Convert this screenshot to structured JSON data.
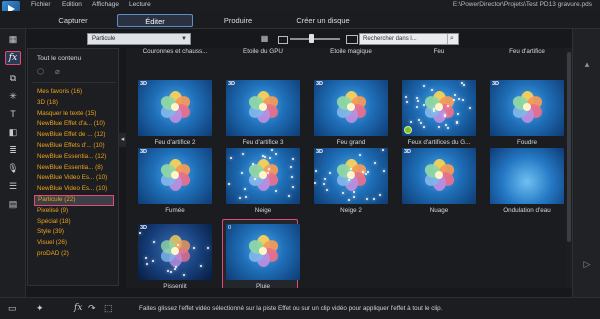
{
  "menu": {
    "items": [
      "Fichier",
      "Edition",
      "Affichage",
      "Lecture"
    ],
    "file_path": "E:\\PowerDirector\\Projets\\Test PD13 gravure.pds"
  },
  "modes": {
    "tabs": [
      "Capturer",
      "Éditer",
      "Produire",
      "Créer un disque"
    ],
    "active": "Éditer"
  },
  "filter": {
    "selected": "Particule",
    "search_placeholder": "Rechercher dans l..."
  },
  "categories": {
    "header": "Tout le contenu",
    "items": [
      "Mes favoris  (16)",
      "3D  (18)",
      "Masquer le texte  (15)",
      "NewBlue Effet d'a...  (10)",
      "NewBlue Effet de ...  (12)",
      "NewBlue Effets d'...  (10)",
      "NewBlue Essentia...  (12)",
      "NewBlue Essentia...  (8)",
      "NewBlue Video Es...  (10)",
      "NewBlue Video Es...  (10)",
      "Particule  (22)",
      "Pixelisé  (9)",
      "Spécial  (18)",
      "Style  (39)",
      "Visuel  (26)",
      "proDAD  (2)"
    ],
    "selected_index": 10
  },
  "effects": [
    {
      "label": "Couronnes et chauss...",
      "badge": "",
      "variant": "cut"
    },
    {
      "label": "Étoile du GPU",
      "badge": "",
      "variant": "cut"
    },
    {
      "label": "Étoile magique",
      "badge": "",
      "variant": "cut"
    },
    {
      "label": "Feu",
      "badge": "",
      "variant": "cut"
    },
    {
      "label": "Feu d'artifice",
      "badge": "",
      "variant": "cut"
    },
    {
      "label": "Feu d'artifice 2",
      "badge": "3D",
      "variant": "flower"
    },
    {
      "label": "Feu d'artifice 3",
      "badge": "3D",
      "variant": "flower"
    },
    {
      "label": "Feu grand",
      "badge": "3D",
      "variant": "flower"
    },
    {
      "label": "Feux d'artifices du G...",
      "badge": "",
      "variant": "burst"
    },
    {
      "label": "Foudre",
      "badge": "3D",
      "variant": "flower"
    },
    {
      "label": "Fumée",
      "badge": "3D",
      "variant": "flower"
    },
    {
      "label": "Neige",
      "badge": "",
      "variant": "snow"
    },
    {
      "label": "Neige 2",
      "badge": "3D",
      "variant": "snow"
    },
    {
      "label": "Nuage",
      "badge": "3D",
      "variant": "flower"
    },
    {
      "label": "Ondulation d'eau",
      "badge": "",
      "variant": "water"
    },
    {
      "label": "Pissenlit",
      "badge": "3D",
      "variant": "dark"
    },
    {
      "label": "Pluie",
      "badge": "0",
      "variant": "flower"
    }
  ],
  "selected_effect": "Pluie",
  "status": {
    "hint": "Faites glissez l'effet vidéo sélectionné sur la piste Effet ou sur un clip vidéo pour appliquer l'effet à tout le clip."
  },
  "icons": {
    "fx": "fx-icon",
    "grid": "grid-view-icon",
    "search": "search-icon"
  },
  "colors": {
    "accent_highlight": "#e24a7a",
    "category_text": "#f0a31a",
    "active_tab_border": "#5f8ec7"
  }
}
